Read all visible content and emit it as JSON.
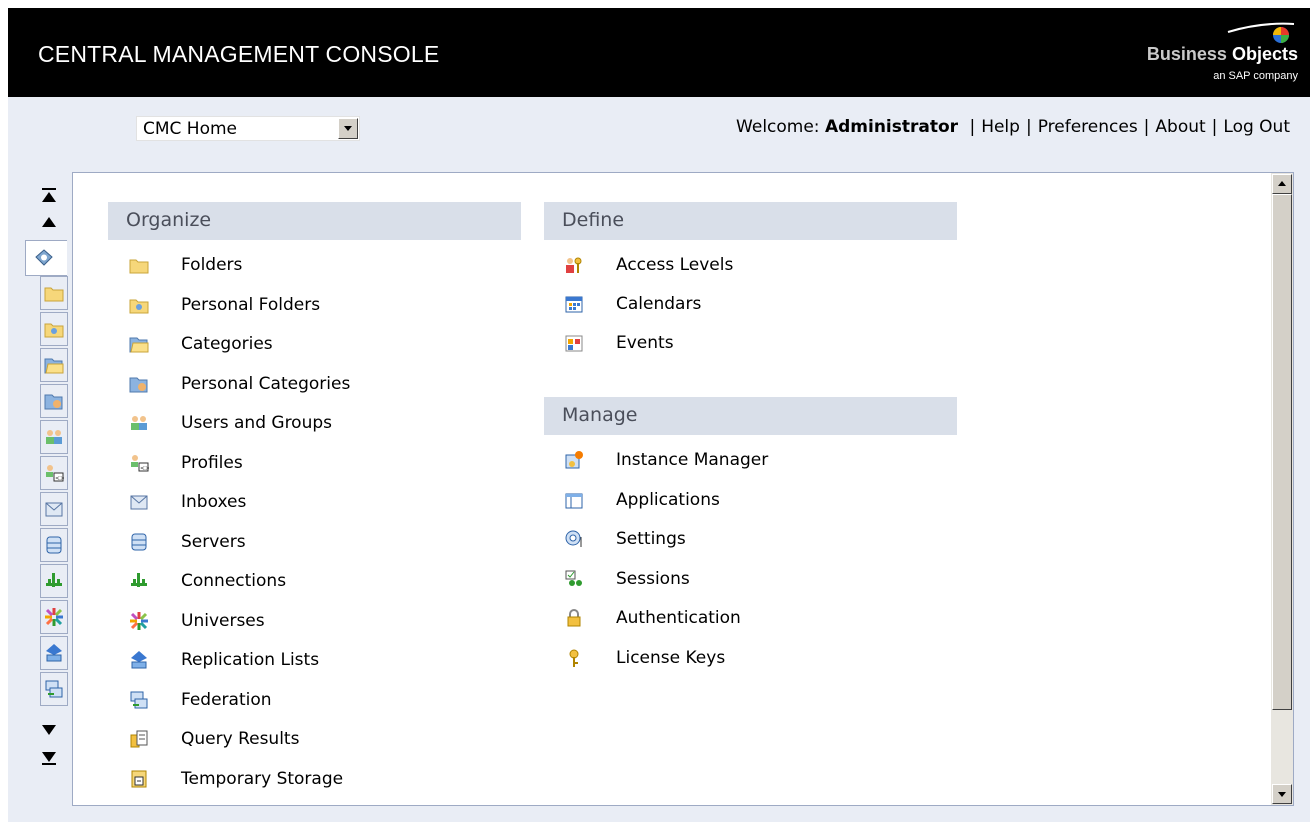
{
  "header": {
    "title": "CENTRAL MANAGEMENT CONSOLE",
    "logo_word_1": "Business",
    "logo_word_2": "Objects",
    "logo_tagline": "an SAP company"
  },
  "nav_select": {
    "value": "CMC Home"
  },
  "top_links": {
    "welcome": "Welcome:",
    "user": "Administrator",
    "help": "Help",
    "preferences": "Preferences",
    "about": "About",
    "logout": "Log Out",
    "separator": "|"
  },
  "sections": {
    "organize": {
      "title": "Organize",
      "items": [
        {
          "label": "Folders",
          "icon": "folder-icon"
        },
        {
          "label": "Personal Folders",
          "icon": "personal-folder-icon"
        },
        {
          "label": "Categories",
          "icon": "categories-icon"
        },
        {
          "label": "Personal Categories",
          "icon": "personal-categories-icon"
        },
        {
          "label": "Users and Groups",
          "icon": "users-groups-icon"
        },
        {
          "label": "Profiles",
          "icon": "profiles-icon"
        },
        {
          "label": "Inboxes",
          "icon": "inbox-icon"
        },
        {
          "label": "Servers",
          "icon": "servers-icon"
        },
        {
          "label": "Connections",
          "icon": "connections-icon"
        },
        {
          "label": "Universes",
          "icon": "universes-icon"
        },
        {
          "label": "Replication Lists",
          "icon": "replication-lists-icon"
        },
        {
          "label": "Federation",
          "icon": "federation-icon"
        },
        {
          "label": "Query Results",
          "icon": "query-results-icon"
        },
        {
          "label": "Temporary Storage",
          "icon": "temporary-storage-icon"
        }
      ]
    },
    "define": {
      "title": "Define",
      "items": [
        {
          "label": "Access Levels",
          "icon": "access-levels-icon"
        },
        {
          "label": "Calendars",
          "icon": "calendar-icon"
        },
        {
          "label": "Events",
          "icon": "events-icon"
        }
      ]
    },
    "manage": {
      "title": "Manage",
      "items": [
        {
          "label": "Instance Manager",
          "icon": "instance-manager-icon"
        },
        {
          "label": "Applications",
          "icon": "applications-icon"
        },
        {
          "label": "Settings",
          "icon": "settings-icon"
        },
        {
          "label": "Sessions",
          "icon": "sessions-icon"
        },
        {
          "label": "Authentication",
          "icon": "lock-icon"
        },
        {
          "label": "License Keys",
          "icon": "key-icon"
        }
      ]
    }
  },
  "side_toolbar": {
    "icons": [
      "home-icon",
      "folder-icon",
      "personal-folder-icon",
      "categories-icon",
      "personal-categories-icon",
      "users-groups-icon",
      "profiles-icon",
      "inbox-icon",
      "servers-icon",
      "connections-icon",
      "universes-icon",
      "replication-lists-icon",
      "federation-icon"
    ]
  },
  "colors": {
    "header_bg": "#000000",
    "page_bg": "#e9edf5",
    "section_header_bg": "#d9dfe9",
    "panel_border": "#9eaac4"
  }
}
